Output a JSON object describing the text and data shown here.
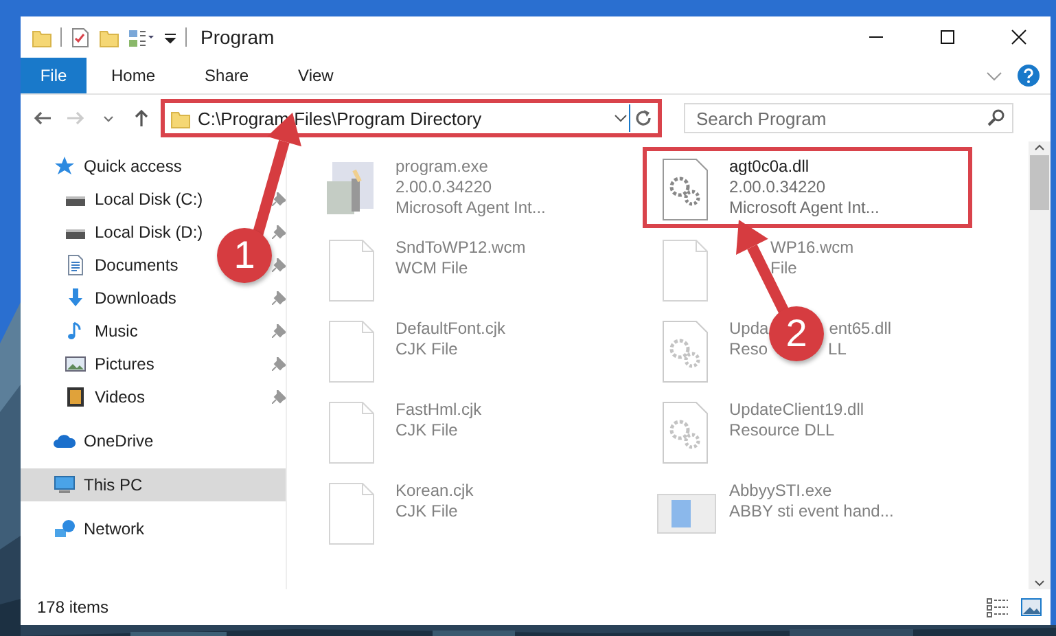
{
  "window": {
    "title": "Program"
  },
  "ribbon_tabs": [
    {
      "label": "File",
      "kind": "file"
    },
    {
      "label": "Home",
      "kind": "tab"
    },
    {
      "label": "Share",
      "kind": "tab"
    },
    {
      "label": "View",
      "kind": "tab"
    }
  ],
  "address": {
    "path": "C:\\Program Files\\Program Directory",
    "highlighted": true
  },
  "search": {
    "placeholder": "Search Program"
  },
  "nav": [
    {
      "label": "Quick access",
      "kind": "star",
      "selected": false,
      "children": [
        {
          "label": "Local Disk (C:)",
          "kind": "drive",
          "pinned": true,
          "selected": false
        },
        {
          "label": "Local Disk (D:)",
          "kind": "drive",
          "pinned": true,
          "selected": false
        },
        {
          "label": "Documents",
          "kind": "documents",
          "pinned": true,
          "selected": false
        },
        {
          "label": "Downloads",
          "kind": "downloads",
          "pinned": true,
          "selected": false
        },
        {
          "label": "Music",
          "kind": "music",
          "pinned": true,
          "selected": false
        },
        {
          "label": "Pictures",
          "kind": "pictures",
          "pinned": true,
          "selected": false
        },
        {
          "label": "Videos",
          "kind": "videos",
          "pinned": true,
          "selected": false
        }
      ]
    },
    {
      "label": "OneDrive",
      "kind": "cloud",
      "selected": false
    },
    {
      "label": "This PC",
      "kind": "pc",
      "selected": true
    },
    {
      "label": "Network",
      "kind": "network",
      "selected": false
    }
  ],
  "files": [
    {
      "kind": "exe",
      "name": [
        "program.exe"
      ],
      "details": [
        [
          "2.00.0.34220"
        ],
        [
          "Microsoft Agent Int..."
        ]
      ],
      "dimmed": true,
      "highlighted": false,
      "covered_left": false
    },
    {
      "kind": "dll",
      "name": [
        "agt0c0a.dll"
      ],
      "details": [
        [
          "2.00.0.34220"
        ],
        [
          "Microsoft Agent Int..."
        ]
      ],
      "dimmed": false,
      "highlighted": true,
      "covered_left": false
    },
    {
      "kind": "file",
      "name": [
        "SndToWP12.wcm"
      ],
      "details": [
        [
          "WCM File"
        ]
      ],
      "dimmed": true,
      "highlighted": false,
      "covered_left": false
    },
    {
      "kind": "file",
      "name": [
        "WP16.wcm"
      ],
      "details": [
        [
          "File"
        ]
      ],
      "dimmed": true,
      "highlighted": false,
      "covered_left": true
    },
    {
      "kind": "file",
      "name": [
        "DefaultFont.cjk"
      ],
      "details": [
        [
          "CJK File"
        ]
      ],
      "dimmed": true,
      "highlighted": false,
      "covered_left": false
    },
    {
      "kind": "dll",
      "name": [
        "Upda",
        "ent65.dll"
      ],
      "details": [
        [
          "Reso",
          "LL"
        ]
      ],
      "dimmed": true,
      "highlighted": false,
      "covered_left": false
    },
    {
      "kind": "file",
      "name": [
        "FastHml.cjk"
      ],
      "details": [
        [
          "CJK File"
        ]
      ],
      "dimmed": true,
      "highlighted": false,
      "covered_left": false
    },
    {
      "kind": "dll",
      "name": [
        "UpdateClient19.dll"
      ],
      "details": [
        [
          "Resource DLL"
        ]
      ],
      "dimmed": true,
      "highlighted": false,
      "covered_left": false
    },
    {
      "kind": "file",
      "name": [
        "Korean.cjk"
      ],
      "details": [
        [
          "CJK File"
        ]
      ],
      "dimmed": true,
      "highlighted": false,
      "covered_left": false
    },
    {
      "kind": "app",
      "name": [
        "AbbyySTI.exe"
      ],
      "details": [
        [
          "ABBY sti event hand..."
        ]
      ],
      "dimmed": true,
      "highlighted": false,
      "covered_left": false
    }
  ],
  "annotations": [
    {
      "label": "1"
    },
    {
      "label": "2"
    }
  ],
  "status_bar": {
    "count": "178 items"
  }
}
